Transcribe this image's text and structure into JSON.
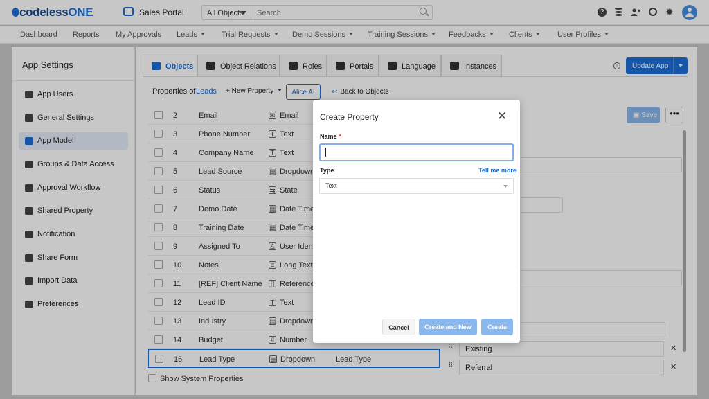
{
  "brand": {
    "logo": "codelessONE",
    "logo_main": "codeless",
    "logo_suffix": "ONE",
    "app_name": "Sales Portal"
  },
  "search": {
    "scope": "All Objects",
    "placeholder": "Search"
  },
  "nav": [
    "Dashboard",
    "Reports",
    "My Approvals",
    "Leads",
    "Trial Requests",
    "Demo Sessions",
    "Training Sessions",
    "Feedbacks",
    "Clients",
    "User Profiles"
  ],
  "sidebar": {
    "title": "App Settings",
    "items": [
      {
        "label": "App Users",
        "icon": "users-icon"
      },
      {
        "label": "General Settings",
        "icon": "gear-icon"
      },
      {
        "label": "App Model",
        "icon": "cube-icon",
        "active": true
      },
      {
        "label": "Groups & Data Access",
        "icon": "group-icon"
      },
      {
        "label": "Approval Workflow",
        "icon": "checklist-icon"
      },
      {
        "label": "Shared Property",
        "icon": "shared-box-icon"
      },
      {
        "label": "Notification",
        "icon": "bell-icon"
      },
      {
        "label": "Share Form",
        "icon": "form-icon"
      },
      {
        "label": "Import Data",
        "icon": "cloud-upload-icon"
      },
      {
        "label": "Preferences",
        "icon": "user-settings-icon"
      }
    ]
  },
  "tabs": [
    "Objects",
    "Object Relations",
    "Roles",
    "Portals",
    "Language",
    "Instances"
  ],
  "toolbar": {
    "update_label": "Update App",
    "props_label": "Properties of",
    "props_object": "Leads",
    "new_property": "New Property",
    "alice": "Alice AI",
    "back": "Back to Objects",
    "save": "Save",
    "more": "•••"
  },
  "properties": [
    {
      "num": "2",
      "name": "Email",
      "type": "Email",
      "icon": "✉"
    },
    {
      "num": "3",
      "name": "Phone Number",
      "type": "Text",
      "icon": "T"
    },
    {
      "num": "4",
      "name": "Company Name",
      "type": "Text",
      "icon": "T"
    },
    {
      "num": "5",
      "name": "Lead Source",
      "type": "Dropdown",
      "icon": "▤"
    },
    {
      "num": "6",
      "name": "Status",
      "type": "State",
      "icon": "⇆"
    },
    {
      "num": "7",
      "name": "Demo Date",
      "type": "Date Time",
      "icon": "▦"
    },
    {
      "num": "8",
      "name": "Training Date",
      "type": "Date Time",
      "icon": "▦"
    },
    {
      "num": "9",
      "name": "Assigned To",
      "type": "User Identi",
      "icon": "♙"
    },
    {
      "num": "10",
      "name": "Notes",
      "type": "Long Text",
      "icon": "≡"
    },
    {
      "num": "11",
      "name": "[REF] Client Name",
      "type": "Referenced",
      "icon": "[]"
    },
    {
      "num": "12",
      "name": "Lead ID",
      "type": "Text",
      "icon": "T"
    },
    {
      "num": "13",
      "name": "Industry",
      "type": "Dropdown",
      "icon": "▤"
    },
    {
      "num": "14",
      "name": "Budget",
      "type": "Number",
      "icon": "#"
    },
    {
      "num": "15",
      "name": "Lead Type",
      "type": "Dropdown",
      "icon": "▤",
      "extra": "Lead Type",
      "selected": true
    }
  ],
  "show_system": "Show System Properties",
  "options": [
    "Existing",
    "Referral"
  ],
  "modal": {
    "title": "Create Property",
    "name_label": "Name",
    "required": "*",
    "name_value": "",
    "type_label": "Type",
    "tell_more": "Tell me more",
    "type_value": "Text",
    "cancel": "Cancel",
    "create_new": "Create and New",
    "create": "Create"
  },
  "colors": {
    "accent": "#1d6fd8",
    "disabled": "#8bb8ec"
  }
}
